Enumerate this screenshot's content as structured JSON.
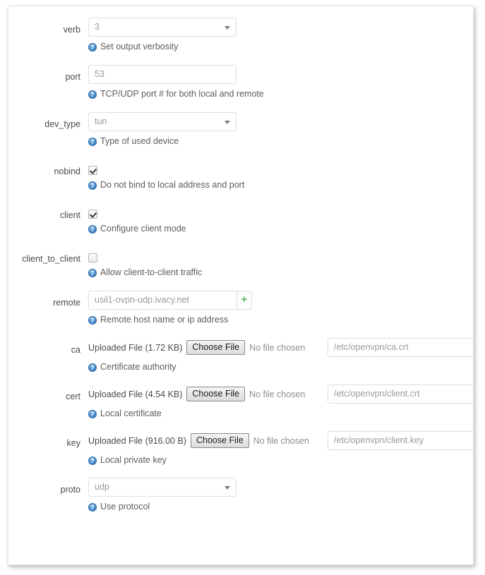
{
  "form": {
    "rows": [
      {
        "id": "verb",
        "label": "verb",
        "type": "select",
        "value": "3",
        "help": "Set output verbosity"
      },
      {
        "id": "port",
        "label": "port",
        "type": "text",
        "value": "53",
        "help": "TCP/UDP port # for both local and remote"
      },
      {
        "id": "dev_type",
        "label": "dev_type",
        "type": "select",
        "value": "tun",
        "help": "Type of used device"
      },
      {
        "id": "nobind",
        "label": "nobind",
        "type": "checkbox",
        "checked": true,
        "help": "Do not bind to local address and port"
      },
      {
        "id": "client",
        "label": "client",
        "type": "checkbox",
        "checked": true,
        "help": "Configure client mode"
      },
      {
        "id": "client_to_client",
        "label": "client_to_client",
        "type": "checkbox",
        "checked": false,
        "help": "Allow client-to-client traffic"
      },
      {
        "id": "remote",
        "label": "remote",
        "type": "text-add",
        "value": "usil1-ovpn-udp.ivacy.net",
        "add_label": "+",
        "help": "Remote host name or ip address"
      },
      {
        "id": "ca",
        "label": "ca",
        "type": "file",
        "uploaded": "Uploaded File (1.72 KB)",
        "choose_label": "Choose File",
        "no_file": "No file chosen",
        "path": "/etc/openvpn/ca.crt",
        "help": "Certificate authority"
      },
      {
        "id": "cert",
        "label": "cert",
        "type": "file",
        "uploaded": "Uploaded File (4.54 KB)",
        "choose_label": "Choose File",
        "no_file": "No file chosen",
        "path": "/etc/openvpn/client.crt",
        "help": "Local certificate"
      },
      {
        "id": "key",
        "label": "key",
        "type": "file",
        "uploaded": "Uploaded File (916.00 B)",
        "choose_label": "Choose File",
        "no_file": "No file chosen",
        "path": "/etc/openvpn/client.key",
        "help": "Local private key"
      },
      {
        "id": "proto",
        "label": "proto",
        "type": "select",
        "value": "udp",
        "help": "Use protocol"
      }
    ],
    "help_icon_glyph": "?",
    "help_icon_name": "help-question-icon"
  },
  "colors": {
    "accent_green": "#5cb85c",
    "help_icon_blue": "#2f6ca5",
    "border": "#dfdfdf",
    "panel_bg": "#ffffff"
  }
}
